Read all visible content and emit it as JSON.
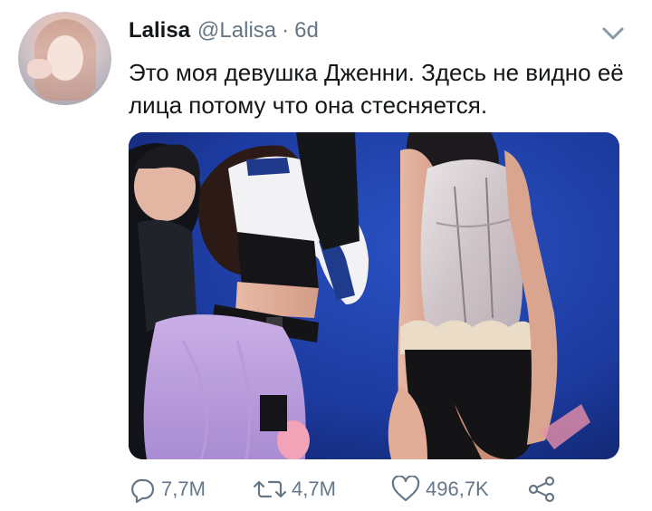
{
  "tweet": {
    "author": {
      "display_name": "Lalisa",
      "handle": "@Lalisa",
      "separator": "·",
      "time": "6d",
      "avatar_icon": "avatar-photo"
    },
    "text": "Это моя девушка Дженни. Здесь не видно её лица потому что она стесняется.",
    "media": {
      "type": "photo",
      "description_icon": "concert-photo"
    },
    "actions": {
      "replies": "7,7M",
      "retweets": "4,7M",
      "likes": "496,7K"
    },
    "icons": {
      "reply": "reply-icon",
      "retweet": "retweet-icon",
      "like": "heart-icon",
      "share": "share-icon",
      "menu": "chevron-down-icon"
    }
  },
  "colors": {
    "text": "#14171a",
    "secondary": "#657786",
    "stage_blue": "#1a3a9a"
  }
}
